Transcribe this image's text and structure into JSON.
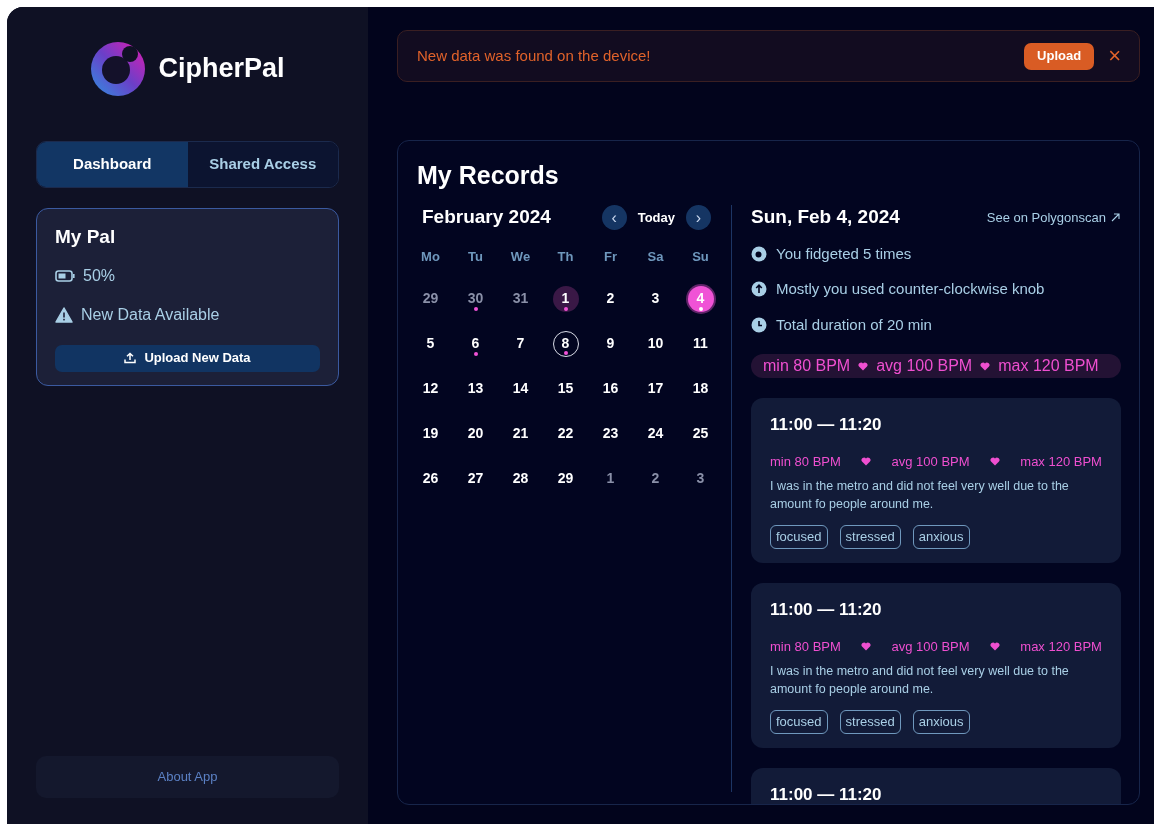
{
  "app": {
    "name": "CipherPal"
  },
  "tabs": [
    {
      "label": "Dashboard",
      "selected": true
    },
    {
      "label": "Shared Access",
      "selected": false
    }
  ],
  "device": {
    "title": "My Pal",
    "battery": "50%",
    "status": "New Data Available",
    "action": "Upload New Data"
  },
  "footer_button": "About App",
  "alert": {
    "message": "New data was found on the device!",
    "action": "Upload",
    "close": "×"
  },
  "records": {
    "title": "My Records",
    "calendar": {
      "month": "February 2024",
      "prev": "‹",
      "today": "Today",
      "next": "›",
      "weekdays": [
        "Mo",
        "Tu",
        "We",
        "Th",
        "Fr",
        "Sa",
        "Su"
      ],
      "days": [
        {
          "label": "29",
          "muted": true,
          "dot": false,
          "selected": false,
          "shaded": false,
          "ringed": false
        },
        {
          "label": "30",
          "muted": true,
          "dot": true,
          "selected": false,
          "shaded": false,
          "ringed": false
        },
        {
          "label": "31",
          "muted": true,
          "dot": false,
          "selected": false,
          "shaded": false,
          "ringed": false
        },
        {
          "label": "1",
          "muted": false,
          "dot": true,
          "selected": false,
          "shaded": true,
          "ringed": false
        },
        {
          "label": "2",
          "muted": false,
          "dot": false,
          "selected": false,
          "shaded": false,
          "ringed": false
        },
        {
          "label": "3",
          "muted": false,
          "dot": false,
          "selected": false,
          "shaded": false,
          "ringed": false
        },
        {
          "label": "4",
          "muted": false,
          "dot": true,
          "selected": true,
          "shaded": false,
          "ringed": false
        },
        {
          "label": "5",
          "muted": false,
          "dot": false,
          "selected": false,
          "shaded": false,
          "ringed": false
        },
        {
          "label": "6",
          "muted": false,
          "dot": true,
          "selected": false,
          "shaded": false,
          "ringed": false
        },
        {
          "label": "7",
          "muted": false,
          "dot": false,
          "selected": false,
          "shaded": false,
          "ringed": false
        },
        {
          "label": "8",
          "muted": false,
          "dot": true,
          "selected": false,
          "shaded": false,
          "ringed": true
        },
        {
          "label": "9",
          "muted": false,
          "dot": false,
          "selected": false,
          "shaded": false,
          "ringed": false
        },
        {
          "label": "10",
          "muted": false,
          "dot": false,
          "selected": false,
          "shaded": false,
          "ringed": false
        },
        {
          "label": "11",
          "muted": false,
          "dot": false,
          "selected": false,
          "shaded": false,
          "ringed": false
        },
        {
          "label": "12",
          "muted": false,
          "dot": false,
          "selected": false,
          "shaded": false,
          "ringed": false
        },
        {
          "label": "13",
          "muted": false,
          "dot": false,
          "selected": false,
          "shaded": false,
          "ringed": false
        },
        {
          "label": "14",
          "muted": false,
          "dot": false,
          "selected": false,
          "shaded": false,
          "ringed": false
        },
        {
          "label": "15",
          "muted": false,
          "dot": false,
          "selected": false,
          "shaded": false,
          "ringed": false
        },
        {
          "label": "16",
          "muted": false,
          "dot": false,
          "selected": false,
          "shaded": false,
          "ringed": false
        },
        {
          "label": "17",
          "muted": false,
          "dot": false,
          "selected": false,
          "shaded": false,
          "ringed": false
        },
        {
          "label": "18",
          "muted": false,
          "dot": false,
          "selected": false,
          "shaded": false,
          "ringed": false
        },
        {
          "label": "19",
          "muted": false,
          "dot": false,
          "selected": false,
          "shaded": false,
          "ringed": false
        },
        {
          "label": "20",
          "muted": false,
          "dot": false,
          "selected": false,
          "shaded": false,
          "ringed": false
        },
        {
          "label": "21",
          "muted": false,
          "dot": false,
          "selected": false,
          "shaded": false,
          "ringed": false
        },
        {
          "label": "22",
          "muted": false,
          "dot": false,
          "selected": false,
          "shaded": false,
          "ringed": false
        },
        {
          "label": "23",
          "muted": false,
          "dot": false,
          "selected": false,
          "shaded": false,
          "ringed": false
        },
        {
          "label": "24",
          "muted": false,
          "dot": false,
          "selected": false,
          "shaded": false,
          "ringed": false
        },
        {
          "label": "25",
          "muted": false,
          "dot": false,
          "selected": false,
          "shaded": false,
          "ringed": false
        },
        {
          "label": "26",
          "muted": false,
          "dot": false,
          "selected": false,
          "shaded": false,
          "ringed": false
        },
        {
          "label": "27",
          "muted": false,
          "dot": false,
          "selected": false,
          "shaded": false,
          "ringed": false
        },
        {
          "label": "28",
          "muted": false,
          "dot": false,
          "selected": false,
          "shaded": false,
          "ringed": false
        },
        {
          "label": "29",
          "muted": false,
          "dot": false,
          "selected": false,
          "shaded": false,
          "ringed": false
        },
        {
          "label": "1",
          "muted": true,
          "dot": false,
          "selected": false,
          "shaded": false,
          "ringed": false
        },
        {
          "label": "2",
          "muted": true,
          "dot": false,
          "selected": false,
          "shaded": false,
          "ringed": false
        },
        {
          "label": "3",
          "muted": true,
          "dot": false,
          "selected": false,
          "shaded": false,
          "ringed": false
        }
      ]
    },
    "day": {
      "date": "Sun, Feb 4, 2024",
      "link": "See on Polygonscan",
      "facts": [
        {
          "kind": "fidget",
          "text": "You fidgeted 5 times"
        },
        {
          "kind": "knob",
          "text": "Mostly you used counter-clockwise knob"
        },
        {
          "kind": "duration",
          "text": "Total duration of 20 min"
        }
      ],
      "bpm": [
        "min 80 BPM",
        "avg 100 BPM",
        "max 120 BPM"
      ]
    },
    "entries": [
      {
        "time": "11:00 — 11:20",
        "bpm": [
          "min 80 BPM",
          "avg 100 BPM",
          "max 120 BPM"
        ],
        "note": "I was in the metro and did not feel very well due to the amount fo people around me.",
        "tags": [
          "focused",
          "stressed",
          "anxious"
        ]
      },
      {
        "time": "11:00 — 11:20",
        "bpm": [
          "min 80 BPM",
          "avg 100 BPM",
          "max 120 BPM"
        ],
        "note": "I was in the metro and did not feel very well due to the amount fo people around me.",
        "tags": [
          "focused",
          "stressed",
          "anxious"
        ]
      },
      {
        "time": "11:00 — 11:20"
      }
    ]
  }
}
